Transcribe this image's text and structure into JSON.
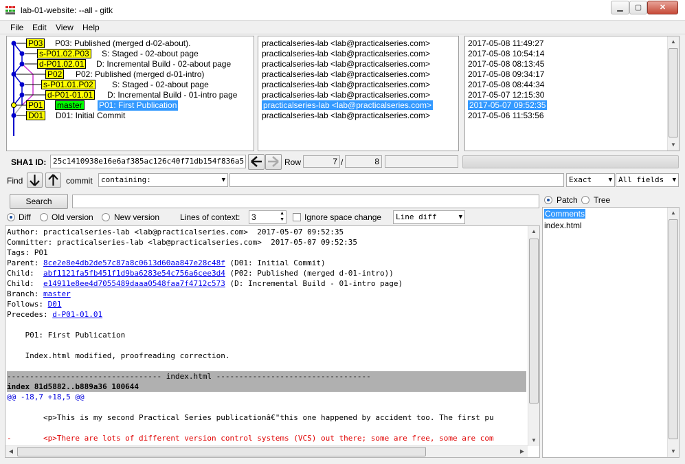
{
  "window": {
    "title": "lab-01-website: --all - gitk",
    "controls": {
      "minimize": "▁",
      "maximize": "▢",
      "close": "✕"
    }
  },
  "menu": [
    "File",
    "Edit",
    "View",
    "Help"
  ],
  "refs": {
    "P03": "P03",
    "sP0102P03": "s-P01.02.P03",
    "dP010201": "d-P01.02.01",
    "P02": "P02",
    "sP0101P02": "s-P01.01.P02",
    "dP010101": "d-P01-01.01",
    "P01": "P01",
    "master": "master",
    "D01": "D01"
  },
  "commits": [
    {
      "subject": "P03: Published (merged d-02-about).",
      "author": "practicalseries-lab <lab@practicalseries.com>",
      "date": "2017-05-08 11:49:27"
    },
    {
      "subject": "S: Staged - 02-about page",
      "author": "practicalseries-lab <lab@practicalseries.com>",
      "date": "2017-05-08 10:54:14"
    },
    {
      "subject": "D: Incremental Build - 02-about page",
      "author": "practicalseries-lab <lab@practicalseries.com>",
      "date": "2017-05-08 08:13:45"
    },
    {
      "subject": "P02: Published (merged d-01-intro)",
      "author": "practicalseries-lab <lab@practicalseries.com>",
      "date": "2017-05-08 09:34:17"
    },
    {
      "subject": "S: Staged - 02-about page",
      "author": "practicalseries-lab <lab@practicalseries.com>",
      "date": "2017-05-08 08:44:34"
    },
    {
      "subject": "D: Incremental Build - 01-intro page",
      "author": "practicalseries-lab <lab@practicalseries.com>",
      "date": "2017-05-07 12:15:30"
    },
    {
      "subject": "P01: First Publication",
      "author": "practicalseries-lab <lab@practicalseries.com>",
      "date": "2017-05-07 09:52:35"
    },
    {
      "subject": "D01: Initial Commit",
      "author": "practicalseries-lab <lab@practicalseries.com>",
      "date": "2017-05-06 11:53:56"
    }
  ],
  "sha": {
    "label": "SHA1 ID:",
    "value": "25c1410938e16e6af385ac126c40f71db154f836a5"
  },
  "row": {
    "label": "Row",
    "current": "7",
    "sep": "/",
    "total": "8"
  },
  "find": {
    "label": "Find",
    "commit_label": "commit",
    "mode": "containing:",
    "match": "Exact",
    "fields": "All fields"
  },
  "search": {
    "button": "Search"
  },
  "diffopts": {
    "diff": "Diff",
    "old": "Old version",
    "new": "New version",
    "context_label": "Lines of context:",
    "context_value": "3",
    "ignore_space": "Ignore space change",
    "line_diff": "Line diff"
  },
  "filetree": {
    "patch": "Patch",
    "tree": "Tree",
    "items": [
      "Comments",
      "index.html"
    ]
  },
  "diff": {
    "author": "Author: practicalseries-lab <lab@practicalseries.com>  2017-05-07 09:52:35",
    "committer": "Committer: practicalseries-lab <lab@practicalseries.com>  2017-05-07 09:52:35",
    "tags": "Tags: P01",
    "parent_label": "Parent: ",
    "parent_sha": "8ce2e8e4db2de57c87a8c0613d60aa847e28c48f",
    "parent_desc": " (D01: Initial Commit)",
    "child1_label": "Child:  ",
    "child1_sha": "abf1121fa5fb451f1d9ba6283e54c756a6cee3d4",
    "child1_desc": " (P02: Published (merged d-01-intro))",
    "child2_label": "Child:  ",
    "child2_sha": "e14911e8ee4d7055489daaa0548faa7f4712c573",
    "child2_desc": " (D: Incremental Build - 01-intro page)",
    "branch_label": "Branch: ",
    "branch": "master",
    "follows_label": "Follows: ",
    "follows": "D01",
    "precedes_label": "Precedes: ",
    "precedes": "d-P01-01.01",
    "msg1": "    P01: First Publication",
    "msg2": "    Index.html modified, proofreading correction.",
    "file_header": "---------------------------------- index.html ----------------------------------",
    "index_line": "index 81d5882..b889a36 100644",
    "hunk": "@@ -18,7 +18,5 @@",
    "ctx_line": "        <p>This is my second Practical Series publicationâ€\"this one happened by accident too. The first pu",
    "del_line": "-       <p>There are lots of different version control systems (VCS) out there; some are free, some are com"
  },
  "colors": {
    "selection": "#3399ff",
    "ref": "#ffff00",
    "head": "#00ff00",
    "graph_blue": "#0000cc",
    "graph_magenta": "#cc33cc",
    "graph_grey": "#aaaaaa"
  }
}
